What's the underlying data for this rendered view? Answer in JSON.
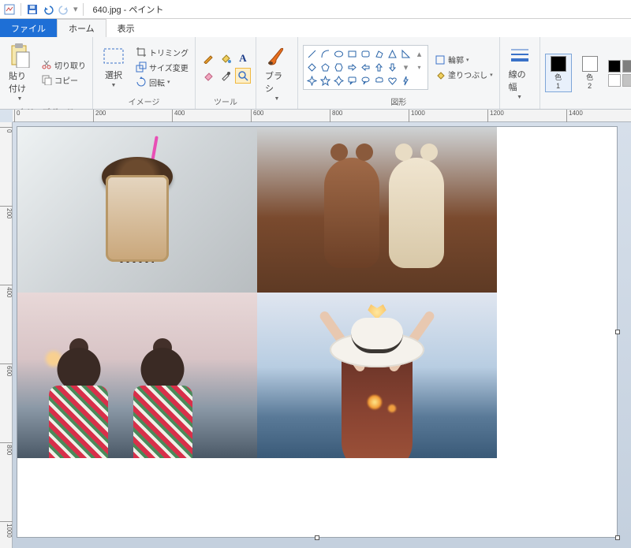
{
  "title": "640.jpg - ペイント",
  "tabs": {
    "file": "ファイル",
    "home": "ホーム",
    "view": "表示"
  },
  "clipboard": {
    "paste": "貼り付け",
    "cut": "切り取り",
    "copy": "コピー",
    "label": "クリップボード"
  },
  "image": {
    "select": "選択",
    "crop": "トリミング",
    "resize": "サイズ変更",
    "rotate": "回転",
    "label": "イメージ"
  },
  "tools": {
    "label": "ツール"
  },
  "brushes": {
    "btn": "ブラシ",
    "label": ""
  },
  "shapes": {
    "outline": "輪郭",
    "fill": "塗りつぶし",
    "label": "図形"
  },
  "size": {
    "label": "線の幅"
  },
  "colors": {
    "c1": "色\n1",
    "c2": "色\n2",
    "c1_hex": "#000000",
    "c2_hex": "#ffffff",
    "swatches": [
      "#000000",
      "#7f7f7f",
      "#ffffff",
      "#c0c0c0",
      "#e0e0e0",
      "#f5f5f5"
    ]
  },
  "ruler_h": [
    "0",
    "200",
    "400",
    "600",
    "800",
    "1000",
    "1200",
    "1400"
  ],
  "ruler_v": [
    "0",
    "200",
    "400",
    "600",
    "800",
    "1000"
  ]
}
